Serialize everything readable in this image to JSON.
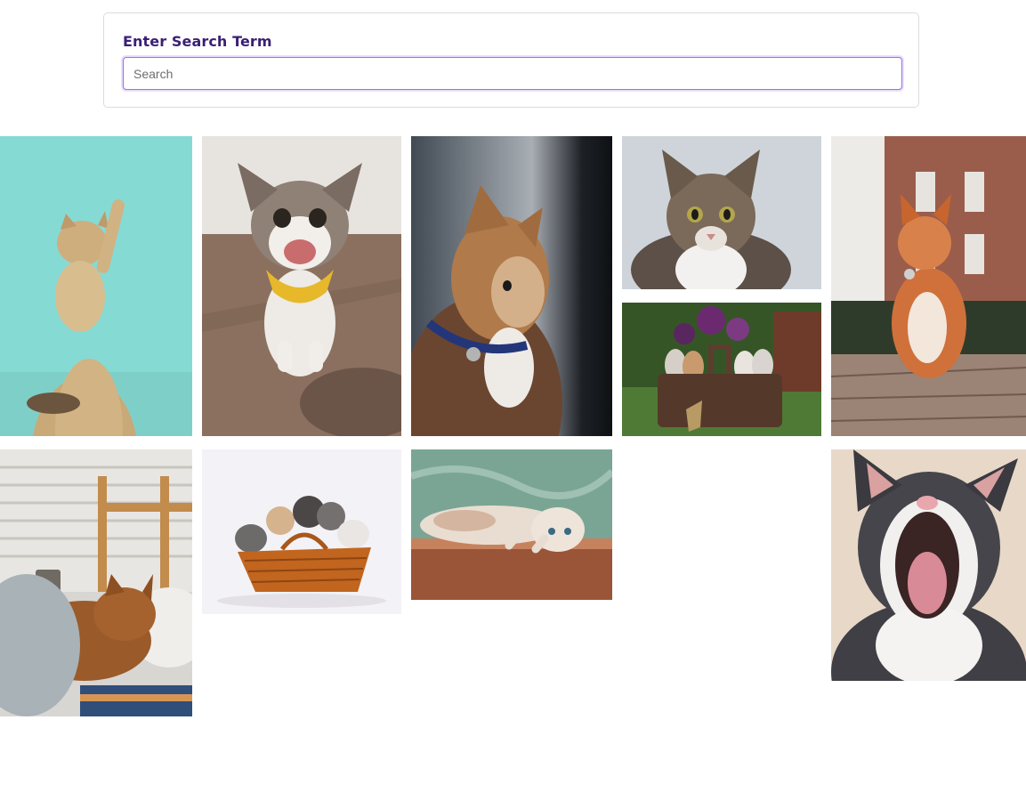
{
  "search": {
    "label": "Enter Search Term",
    "placeholder": "Search",
    "value": "",
    "accent_color": "#9b6cf0",
    "label_color": "#3b1f74"
  },
  "gallery": {
    "images": [
      {
        "subject": "kitten-raising-paw",
        "bg": "#86dcd6"
      },
      {
        "subject": "happy-tabby-with-yellow-bandana",
        "bg": "#8a7565"
      },
      {
        "subject": "orange-cat-profile-blue-collar",
        "bg": "#2f3338"
      },
      {
        "subject": "tabby-cat-portrait",
        "bg": "#d2d6dc"
      },
      {
        "subject": "orange-cat-on-cobblestones",
        "bg": "#8a6b58"
      },
      {
        "subject": "kittens-in-basket-on-grass",
        "bg": "#3a5a2c"
      },
      {
        "subject": "cat-sleeping-in-bed",
        "bg": "#cdc7c0"
      },
      {
        "subject": "kittens-in-wicker-basket",
        "bg": "#f3f2f6"
      },
      {
        "subject": "cat-lying-on-wood-floor",
        "bg": "#6e9a8c"
      },
      {
        "subject": "yawning-black-white-cat",
        "bg": "#e6d6c6"
      }
    ]
  }
}
